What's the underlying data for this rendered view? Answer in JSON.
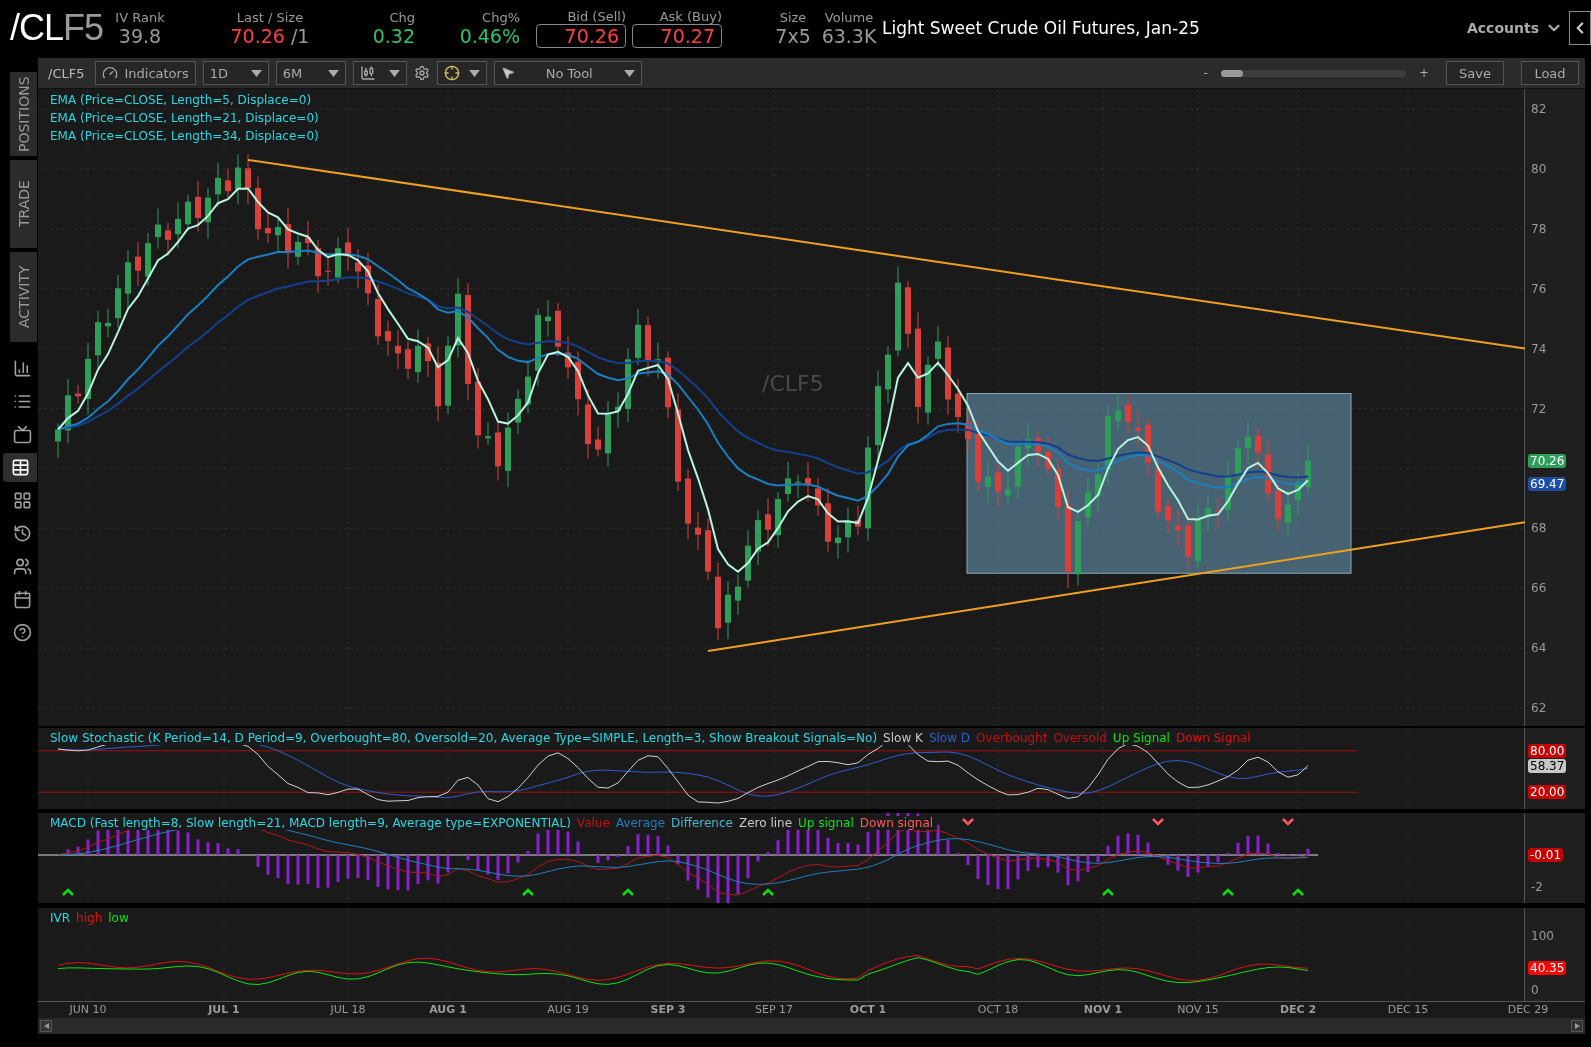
{
  "header": {
    "symbol_root": "/CL",
    "symbol_month": "F5",
    "quotes": [
      {
        "label": "IV Rank",
        "value": "39.8",
        "kind": "plain"
      },
      {
        "label": "Last / Size",
        "value": "70.26",
        "size": "/1",
        "kind": "last"
      },
      {
        "label": "Chg",
        "value": "0.32",
        "kind": "change"
      },
      {
        "label": "Chg%",
        "value": "0.46%",
        "kind": "change"
      },
      {
        "label": "Bid (Sell)",
        "value": "70.26",
        "kind": "box"
      },
      {
        "label": "Ask (Buy)",
        "value": "70.27",
        "kind": "box"
      },
      {
        "label": "Size",
        "value": "7x5",
        "kind": "plain"
      },
      {
        "label": "Volume",
        "value": "63.3K",
        "kind": "plain"
      }
    ],
    "description": "Light Sweet Crude Oil Futures, Jan-25",
    "accounts": "Accounts"
  },
  "sidebar": {
    "tabs": [
      "POSITIONS",
      "TRADE",
      "ACTIVITY"
    ],
    "icon_buttons": [
      {
        "selected": false
      },
      {
        "selected": false
      },
      {
        "selected": false
      },
      {
        "selected": true
      },
      {
        "selected": false
      },
      {
        "selected": false
      },
      {
        "selected": false
      },
      {
        "selected": false
      },
      {
        "selected": false
      }
    ]
  },
  "toolbar": {
    "symbol": "/CLF5",
    "indicators": "Indicators",
    "period": "1D",
    "range": "6M",
    "tool": "No Tool",
    "zoom_out": "-",
    "zoom_in": "+",
    "zoom_slider": {
      "level": 0.12
    },
    "buttons": [
      "Save",
      "Load"
    ]
  },
  "price_panel": {
    "studies": [
      "EMA (Price=CLOSE, Length=5, Displace=0)",
      "EMA (Price=CLOSE, Length=21, Displace=0)",
      "EMA (Price=CLOSE, Length=34, Displace=0)"
    ],
    "watermark": "/CLF5",
    "axis_labels": [
      "82",
      "80",
      "78",
      "76",
      "74",
      "72",
      "68",
      "66",
      "64",
      "62"
    ],
    "badges": [
      {
        "text": "70.26",
        "color": "#2e9e5b"
      },
      {
        "text": "69.47",
        "color": "#1d4ea6"
      }
    ]
  },
  "stochastic_panel": {
    "title": "Slow Stochastic (K Period=14, D Period=9, Overbought=80, Oversold=20, Average Type=SIMPLE, Length=3, Show Breakout Signals=No)",
    "legend": [
      {
        "text": "Slow K",
        "color": "#c8c8c8"
      },
      {
        "text": "Slow D",
        "color": "#2a5fd0"
      },
      {
        "text": "Overbought",
        "color": "#c41010"
      },
      {
        "text": "Oversold",
        "color": "#c41010"
      },
      {
        "text": "Up Signal",
        "color": "#10e010"
      },
      {
        "text": "Down Signal",
        "color": "#e01010"
      }
    ],
    "badges": [
      {
        "text": "80.00",
        "color": "#c40000"
      },
      {
        "text": "58.37",
        "color": "#c8c8c8"
      },
      {
        "text": "20.00",
        "color": "#c40000"
      }
    ]
  },
  "macd_panel": {
    "title": "MACD (Fast length=8, Slow length=21, MACD length=9, Average type=EXPONENTIAL)",
    "legend": [
      {
        "text": "Value",
        "color": "#c41010"
      },
      {
        "text": "Average",
        "color": "#1f7fc0"
      },
      {
        "text": "Difference",
        "color": "#40b8d0"
      },
      {
        "text": "Zero line",
        "color": "#c8c8c8"
      },
      {
        "text": "Up signal",
        "color": "#10e010"
      },
      {
        "text": "Down signal",
        "color": "#ff5a5a"
      }
    ],
    "axis_labels": [
      "-2"
    ],
    "badges": [
      {
        "text": "-0.01",
        "color": "#c40000"
      }
    ]
  },
  "ivr_panel": {
    "title": "IVR",
    "legend": [
      {
        "text": "high",
        "color": "#e01010"
      },
      {
        "text": "low",
        "color": "#10e010"
      }
    ],
    "axis_labels": [
      "100",
      "0"
    ],
    "badges": [
      {
        "text": "40.35",
        "color": "#ff0000"
      }
    ]
  },
  "x_axis": [
    {
      "text": "JUN 10",
      "major": false
    },
    {
      "text": "JUL 1",
      "major": true
    },
    {
      "text": "JUL 18",
      "major": false
    },
    {
      "text": "AUG 1",
      "major": true
    },
    {
      "text": "AUG 19",
      "major": false
    },
    {
      "text": "SEP 3",
      "major": true
    },
    {
      "text": "SEP 17",
      "major": false
    },
    {
      "text": "OCT 1",
      "major": true
    },
    {
      "text": "OCT 18",
      "major": false
    },
    {
      "text": "NOV 1",
      "major": true
    },
    {
      "text": "NOV 15",
      "major": false
    },
    {
      "text": "DEC 2",
      "major": true
    },
    {
      "text": "DEC 15",
      "major": false
    },
    {
      "text": "DEC 29",
      "major": false
    }
  ]
}
